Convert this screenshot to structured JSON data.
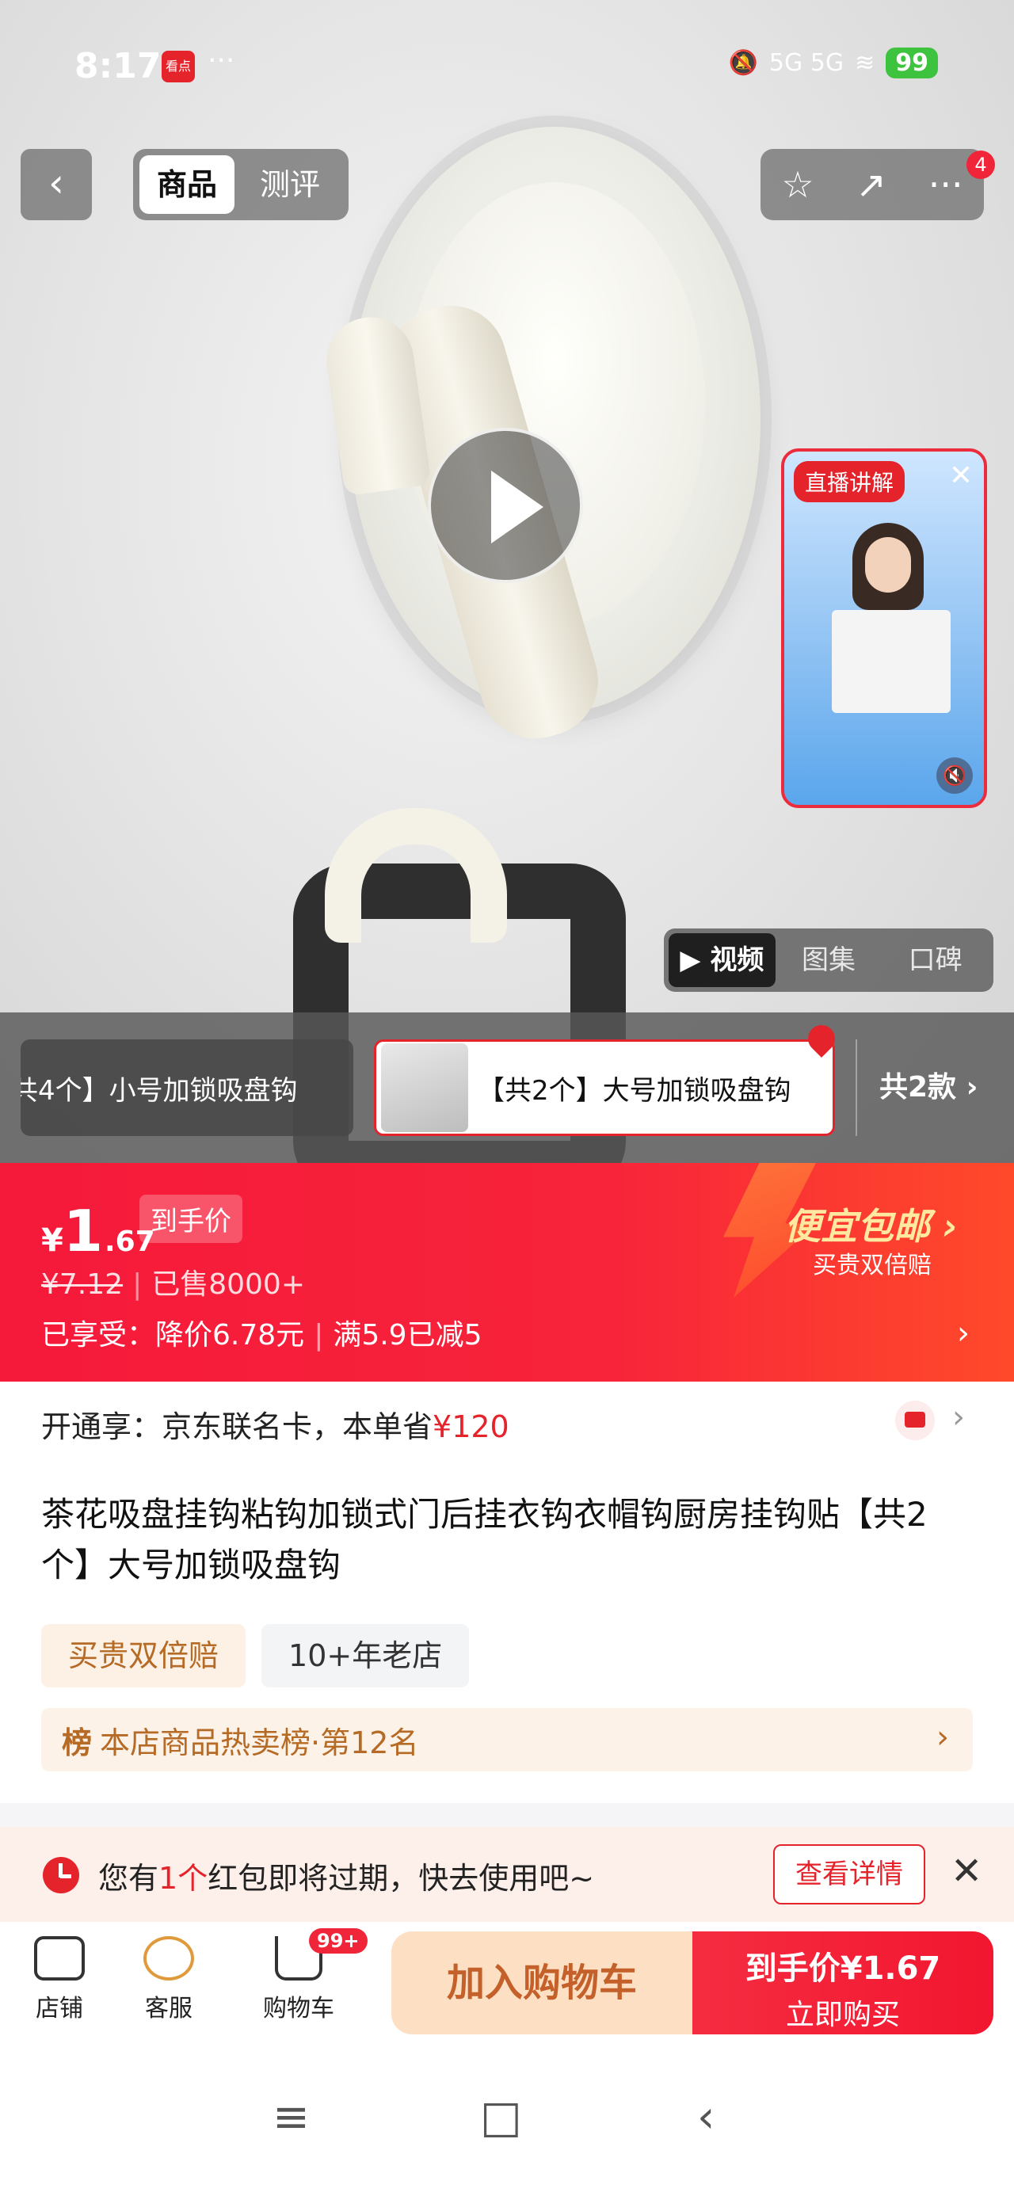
{
  "status_bar": {
    "time": "8:17",
    "app_badge": "看点",
    "dots": "···",
    "network": "5G 5G",
    "battery": "99"
  },
  "header": {
    "back": "‹",
    "tabs": [
      {
        "label": "商品",
        "active": true
      },
      {
        "label": "测评",
        "active": false
      }
    ],
    "actions": {
      "favorite": "☆",
      "share": "↗",
      "more": "···"
    },
    "notification_count": "4"
  },
  "live": {
    "tag": "直播讲解",
    "close": "✕",
    "mute": "🔇"
  },
  "media_tabs": [
    {
      "label": "▶ 视频",
      "active": true
    },
    {
      "label": "图集",
      "active": false
    },
    {
      "label": "口碑",
      "active": false
    }
  ],
  "variants": {
    "previous": "共4个】小号加锁吸盘钩",
    "selected": "【共2个】大号加锁吸盘钩",
    "count": "共2款 ›"
  },
  "price": {
    "yen": "¥",
    "integer": "1",
    "decimal": ".67",
    "tag": "到手价",
    "original": "¥7.12",
    "sold": "已售8000+",
    "enjoy_label": "已享受：",
    "enjoy_discount": "降价6.78元",
    "enjoy_coupon": "满5.9已减5",
    "promo_title": "便宜包邮 ›",
    "promo_sub": "买贵双倍赔"
  },
  "card": {
    "prefix": "开通享：京东联名卡，本单省",
    "amount": "¥120"
  },
  "product": {
    "title": "茶花吸盘挂钩粘钩加锁式门后挂衣钩衣帽钩厨房挂钩贴【共2个】大号加锁吸盘钩",
    "chips": [
      "买贵双倍赔",
      "10+年老店"
    ],
    "rank_icon": "榜",
    "rank_text": "本店商品热卖榜·第12名"
  },
  "coupon": {
    "text_prefix": "您有",
    "text_count": "1个",
    "text_suffix": "红包即将过期，快去使用吧~",
    "button": "查看详情",
    "close": "✕"
  },
  "bottom_bar": {
    "store": "店铺",
    "service": "客服",
    "cart": "购物车",
    "cart_badge": "99+",
    "add_to_cart": "加入购物车",
    "buy_top": "到手价¥1.67",
    "buy_bottom": "立即购买"
  },
  "system_nav": {
    "menu": "≡",
    "home": "□",
    "back": "‹"
  },
  "colors": {
    "brand_red": "#e4232b",
    "promo_gold": "#ffe9a0",
    "cart_orange": "#c4602a"
  }
}
